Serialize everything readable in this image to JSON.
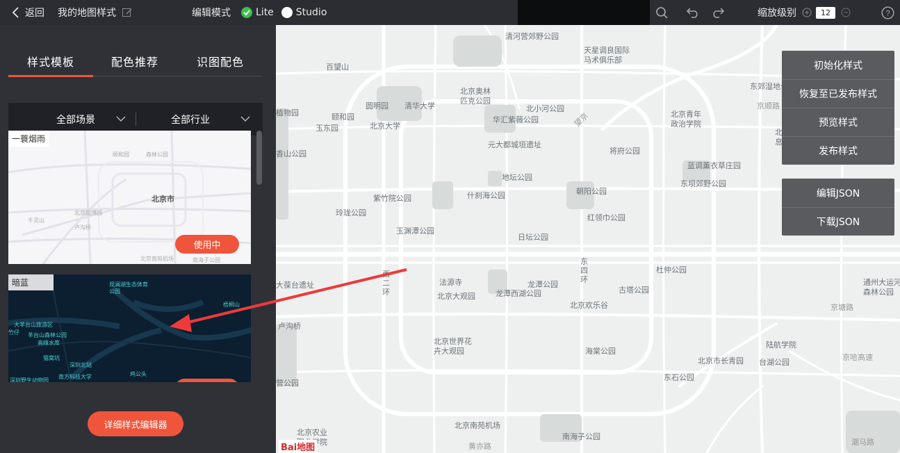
{
  "topbar": {
    "back_label": "返回",
    "title": "我的地图样式",
    "mode_label": "编辑模式",
    "mode_options": [
      "Lite",
      "Studio"
    ],
    "mode_selected": "Lite",
    "zoom_label": "缩放级别",
    "zoom_value": "12",
    "icons": [
      "chevron-left-icon",
      "edit-icon",
      "search-icon",
      "undo-icon",
      "redo-icon",
      "zoom-in-icon",
      "zoom-out-icon",
      "help-icon"
    ]
  },
  "sidebar": {
    "tabs": [
      "样式模板",
      "配色推荐",
      "识图配色"
    ],
    "active_tab": "样式模板",
    "filters": [
      "全部场景",
      "全部行业"
    ],
    "templates": [
      {
        "name": "一蓑烟雨",
        "button": "使用中",
        "labels": [
          "北京市",
          "颐和园",
          "森林公园",
          "北京园博园",
          "千灵山",
          "卢沟桥",
          "北京南苑机场",
          "南海子公园"
        ]
      },
      {
        "name": "暗蓝",
        "labels": [
          "观澜湖生态体育公园",
          "梧桐山",
          "大羊台山旅游区",
          "羊台山森林公园",
          "高峰水库",
          "竹仔",
          "深圳北站",
          "南方科技大学",
          "鸡公头",
          "猫窝坑",
          "深圳野生动物园"
        ]
      }
    ],
    "editor_button": "详细样式编辑器"
  },
  "map": {
    "labels": [
      "清河营郊野公园",
      "百望山",
      "天星调良国际马术俱乐部",
      "北京奥林匹克公园",
      "东郊湿地公园",
      "圆明园",
      "清华大学",
      "颐和园",
      "玉东园",
      "北京大学",
      "北小河公园",
      "华汇紫薇公园",
      "北京青年政治学院",
      "北京电子信息技师学院",
      "元大都城垣遗址",
      "将府公园",
      "京顺路",
      "望京",
      "蓝调薰衣草庄园",
      "东坝郊野公园",
      "地坛公园",
      "什刹海公园",
      "紫竹院公园",
      "朝阳公园",
      "玲珑公园",
      "红领巾公园",
      "玉渊潭公园",
      "日坛公园",
      "西二环",
      "东四环",
      "杜仲公园",
      "法源寺",
      "北京大观园",
      "龙潭公园",
      "龙潭西湖公园",
      "古塔公园",
      "北京欢乐谷",
      "通州大运河森林公园",
      "京塘路",
      "卢沟桥",
      "北京世界花卉大观园",
      "海棠公园",
      "陆航学院",
      "北京市长青园",
      "台湖公园",
      "京哈高速",
      "东石公园",
      "北京南苑机场",
      "南海子公园",
      "黄亦路",
      "北京农业职业学院",
      "潮马路",
      "植物园",
      "香山公园",
      "大葆台遗址",
      "营公园"
    ],
    "logo": "Bai地图"
  },
  "actions": {
    "group1": [
      "初始化样式",
      "恢复至已发布样式",
      "预览样式",
      "发布样式"
    ],
    "group2": [
      "编辑JSON",
      "下载JSON"
    ]
  },
  "colors": {
    "accent": "#f0553b",
    "active_green": "#3bbf4b",
    "panel": "#2f3137",
    "map_bg": "#eef0f0",
    "menu": "#595b5f"
  }
}
